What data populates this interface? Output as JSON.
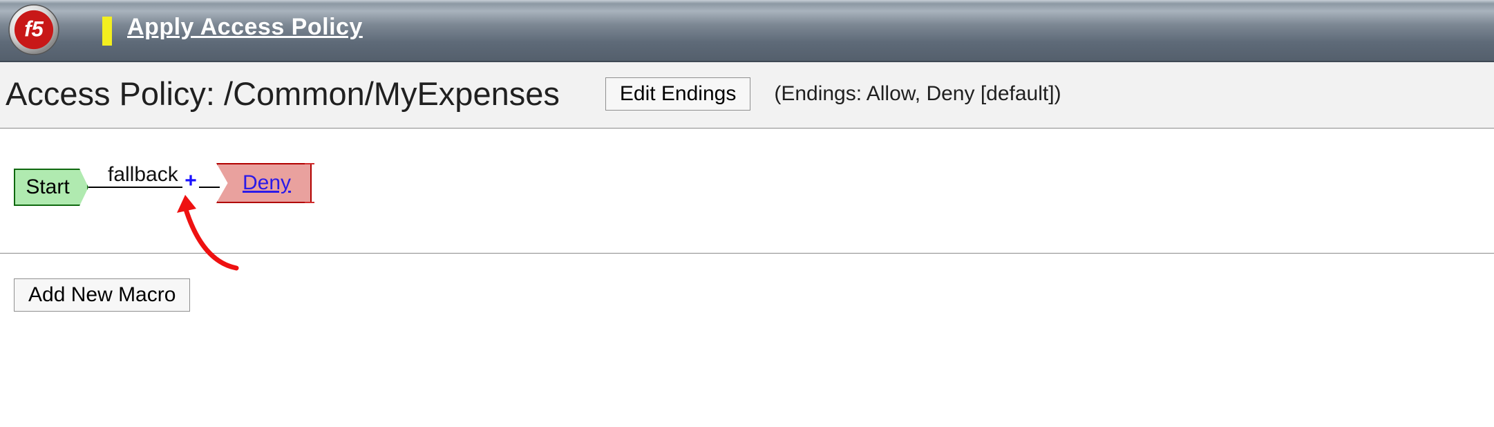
{
  "banner": {
    "apply_link": "Apply Access Policy"
  },
  "header": {
    "title": "Access Policy: /Common/MyExpenses",
    "edit_endings_btn": "Edit Endings",
    "endings_text": "(Endings: Allow, Deny [default])"
  },
  "flow": {
    "start_label": "Start",
    "fallback_label": "fallback",
    "plus_label": "+",
    "deny_label": "Deny"
  },
  "macro": {
    "add_btn": "Add New Macro"
  }
}
